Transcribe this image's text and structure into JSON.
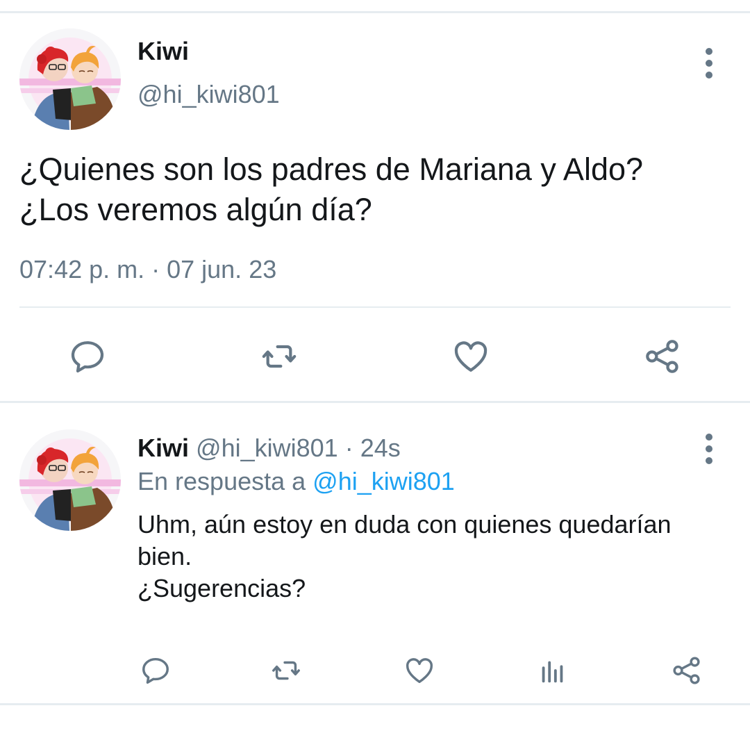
{
  "main_tweet": {
    "author_name": "Kiwi",
    "author_handle": "@hi_kiwi801",
    "text_lines": [
      "¿Quienes son los padres de Mariana y Aldo?",
      "¿Los veremos algún día?"
    ],
    "timestamp": "07:42 p. m. · 07 jun. 23",
    "actions": [
      "reply-icon",
      "retweet-icon",
      "like-icon",
      "share-icon"
    ]
  },
  "reply_tweet": {
    "author_name": "Kiwi",
    "author_handle": "@hi_kiwi801",
    "separator": "·",
    "time_ago": "24s",
    "reply_prefix": "En respuesta a",
    "reply_mention": "@hi_kiwi801",
    "text_lines": [
      "Uhm, aún estoy en duda con quienes quedarían",
      "bien.",
      "¿Sugerencias?"
    ],
    "actions": [
      "reply-icon",
      "retweet-icon",
      "like-icon",
      "analytics-icon",
      "share-icon"
    ]
  },
  "colors": {
    "primary_text": "#14171a",
    "secondary_text": "#657786",
    "link": "#1da1f2",
    "divider": "#e6ecf0"
  }
}
